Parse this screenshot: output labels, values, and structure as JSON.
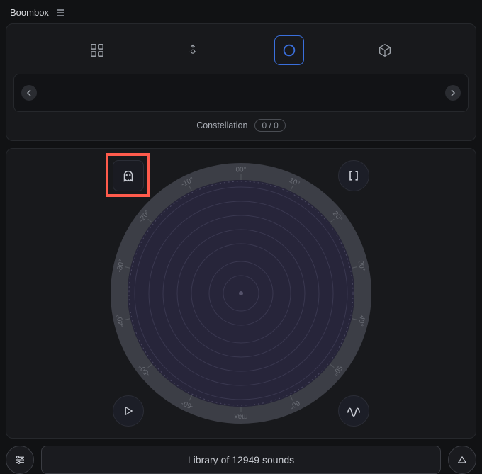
{
  "title": "Boombox",
  "tabs": {
    "grid": "grid-icon",
    "target": "sound-target-icon",
    "orbit": "orbit-icon",
    "cube": "cube-icon",
    "active_index": 2
  },
  "carousel": {
    "count": 0
  },
  "constellation": {
    "label": "Constellation",
    "counter": "0 / 0"
  },
  "orbit": {
    "ticks": [
      "00°",
      "10°",
      "20°",
      "30°",
      "40°",
      "50°",
      "60°",
      "max",
      "-60°",
      "-50°",
      "-40°",
      "-30°",
      "-20°",
      "-10°"
    ]
  },
  "footer": {
    "library_text": "Library of 12949 sounds"
  },
  "colors": {
    "accent": "#3a6fdc",
    "highlight": "#ff5b4c",
    "orbit_fill": "#27253a",
    "orbit_ring": "#3c3e46"
  }
}
